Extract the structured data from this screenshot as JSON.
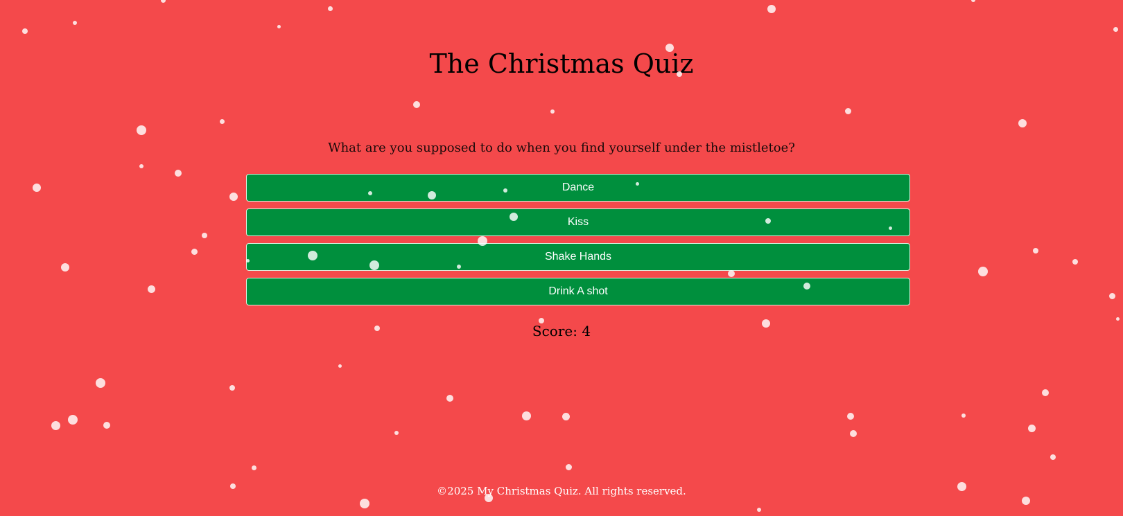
{
  "quiz": {
    "title": "The Christmas Quiz",
    "question": "What are you supposed to do when you find yourself under the mistletoe?",
    "answers": [
      {
        "label": "Dance"
      },
      {
        "label": "Kiss"
      },
      {
        "label": "Shake Hands"
      },
      {
        "label": "Drink A shot"
      }
    ],
    "score_text": "Score: 4"
  },
  "footer": {
    "text": "©2025 My Christmas Quiz. All rights reserved."
  },
  "colors": {
    "background": "#f4494b",
    "answer_button": "#008f3d",
    "answer_text": "#ffffff",
    "snow": "#ffffff"
  }
}
